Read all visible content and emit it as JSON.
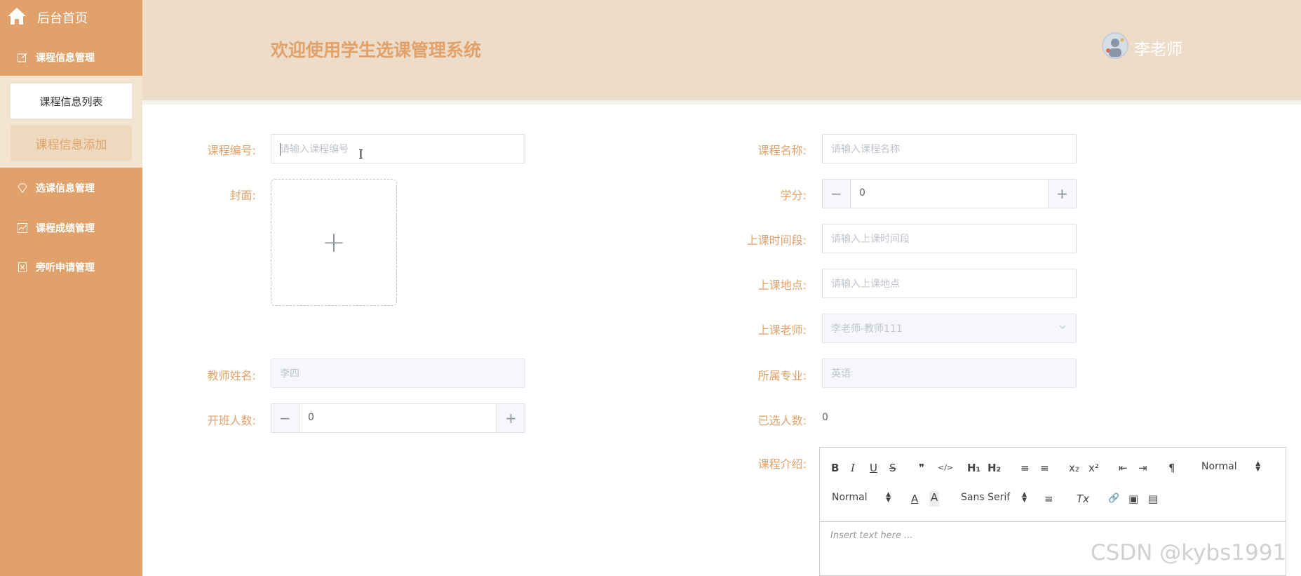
{
  "sidebar": {
    "home_label": "后台首页",
    "menu": [
      {
        "label": "课程信息管理",
        "icon": "edit-icon"
      },
      {
        "label": "选课信息管理",
        "icon": "diamond-icon"
      },
      {
        "label": "课程成绩管理",
        "icon": "chart-icon"
      },
      {
        "label": "旁听申请管理",
        "icon": "document-icon"
      }
    ],
    "submenu": [
      {
        "label": "课程信息列表"
      },
      {
        "label": "课程信息添加",
        "active": true
      }
    ]
  },
  "header": {
    "title": "欢迎使用学生选课管理系统",
    "user_name": "李老师"
  },
  "form": {
    "course_code": {
      "label": "课程编号:",
      "placeholder": "请输入课程编号"
    },
    "cover": {
      "label": "封面:"
    },
    "teacher_name": {
      "label": "教师姓名:",
      "value": "李四"
    },
    "capacity": {
      "label": "开班人数:",
      "value": "0"
    },
    "course_name": {
      "label": "课程名称:",
      "placeholder": "请输入课程名称"
    },
    "credits": {
      "label": "学分:",
      "value": "0"
    },
    "time_slot": {
      "label": "上课时间段:",
      "placeholder": "请输入上课时间段"
    },
    "location": {
      "label": "上课地点:",
      "placeholder": "请输入上课地点"
    },
    "teacher": {
      "label": "上课老师:",
      "value": "李老师-教师111"
    },
    "major": {
      "label": "所属专业:",
      "value": "英语"
    },
    "enrolled": {
      "label": "已选人数:",
      "value": "0"
    },
    "intro": {
      "label": "课程介绍:",
      "placeholder": "Insert text here ..."
    }
  },
  "editor_toolbar": {
    "bold": "B",
    "italic": "I",
    "underline": "U",
    "strike": "S",
    "quote": "❞",
    "code": "</>",
    "h1": "H₁",
    "h2": "H₂",
    "ordered_list": "≡",
    "bullet_list": "≡",
    "subscript": "x₂",
    "superscript": "x²",
    "outdent": "⇤",
    "indent": "⇥",
    "direction": "¶",
    "header_picker": "Normal",
    "size_picker": "Normal",
    "font_picker": "Sans Serif",
    "color": "A",
    "background": "A",
    "align": "≡",
    "clean": "Tx",
    "link": "🔗",
    "image": "▣",
    "video": "▤"
  },
  "watermark": "CSDN @kybs1991",
  "colors": {
    "accent": "#e0a26a",
    "header_bg": "#eddcc8",
    "submenu_bg": "#f3e3d1"
  }
}
